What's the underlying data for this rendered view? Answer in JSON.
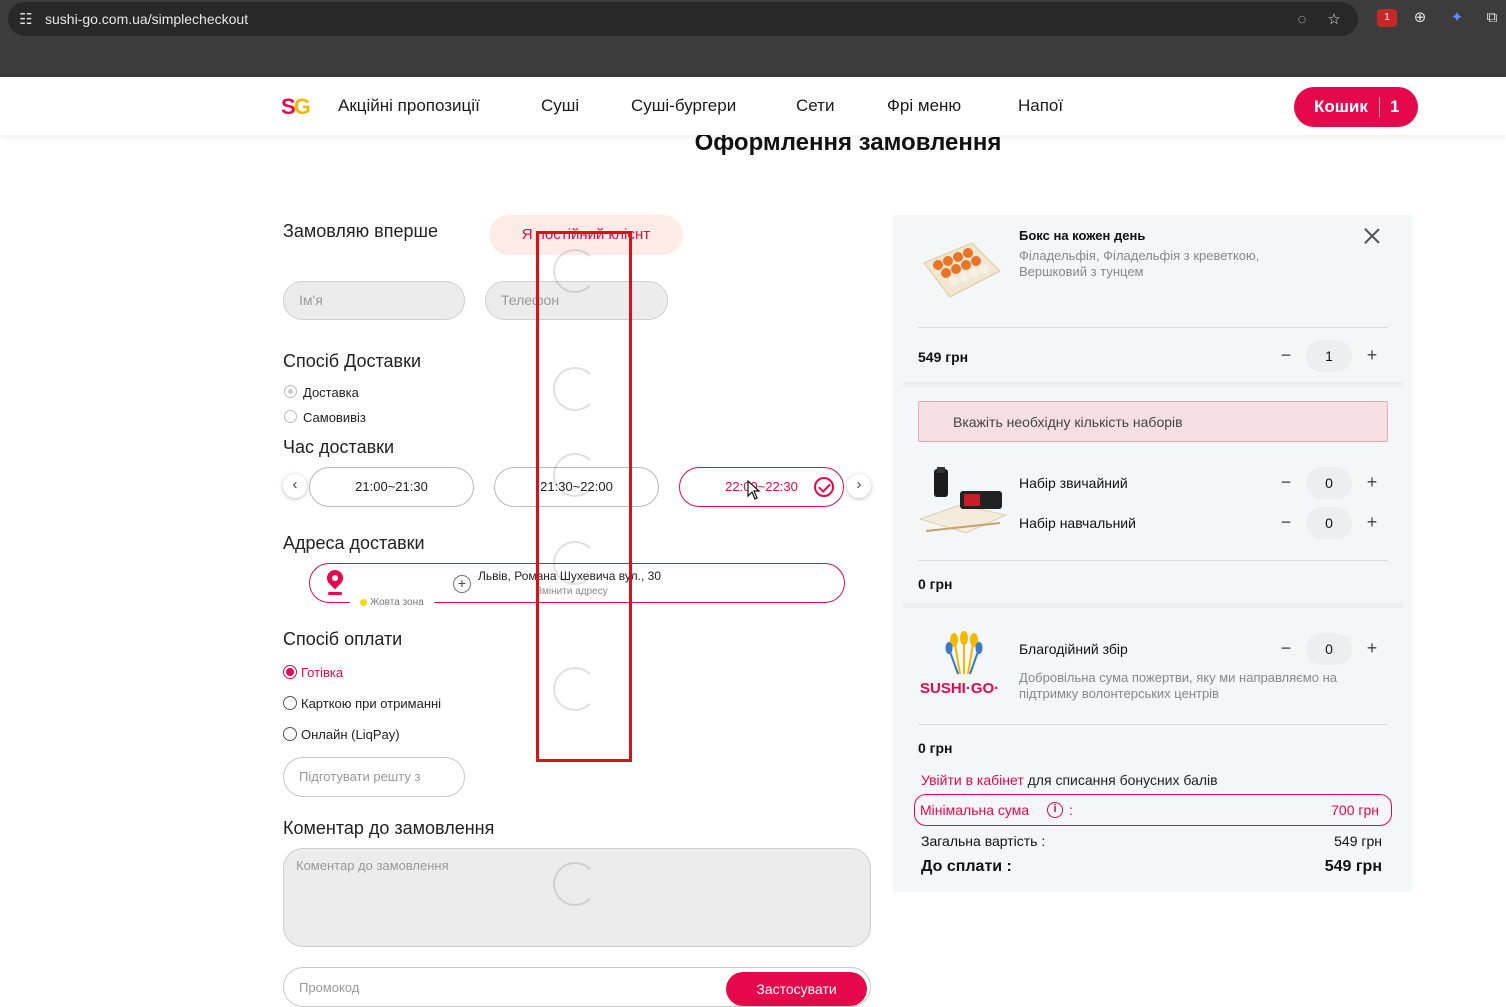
{
  "browser": {
    "url": "sushi-go.com.ua/simplecheckout",
    "extension_badge": "1"
  },
  "header": {
    "logo": {
      "s": "S",
      "g": "G"
    },
    "nav": [
      "Акційні пропозиції",
      "Суші",
      "Суші-бургери",
      "Сети",
      "Фрі меню",
      "Напої"
    ],
    "cart_label": "Кошик",
    "cart_count": "1"
  },
  "page_title": "Оформлення замовлення",
  "customer": {
    "first_time_label": "Замовляю вперше",
    "regular_client_label": "Я постійний клієнт",
    "name_placeholder": "Ім'я",
    "phone_placeholder": "Телефон"
  },
  "delivery": {
    "heading": "Спосіб Доставки",
    "options": [
      {
        "label": "Доставка",
        "selected": true
      },
      {
        "label": "Самовивіз",
        "selected": false
      }
    ]
  },
  "delivery_time": {
    "heading": "Час доставки",
    "slots": [
      {
        "label": "21:00~21:30",
        "active": false
      },
      {
        "label": "21:30~22:00",
        "active": false
      },
      {
        "label": "22:00~22:30",
        "active": true
      }
    ]
  },
  "address": {
    "heading": "Адреса доставки",
    "value": "Львів, Романа Шухевича вул., 30",
    "change_label": "Змінити адресу",
    "zone": "Жовта зона",
    "zone_color": "#f7d31b"
  },
  "payment": {
    "heading": "Спосіб оплати",
    "options": [
      {
        "label": "Готівка",
        "selected": true
      },
      {
        "label": "Карткою при отриманні",
        "selected": false
      },
      {
        "label": "Онлайн (LiqPay)",
        "selected": false
      }
    ],
    "change_placeholder": "Підготувати решту з"
  },
  "comment": {
    "heading": "Коментар до замовлення",
    "placeholder": "Коментар до замовлення"
  },
  "promo": {
    "placeholder": "Промокод",
    "apply_label": "Застосувати"
  },
  "summary": {
    "item": {
      "title": "Бокс на кожен день",
      "description": "Філадельфія, Філадельфія з креветкою, Вершковий з тунцем",
      "price": "549 грн",
      "quantity": "1"
    },
    "sets_warning": "Вкажіть необхідну кількість наборів",
    "sets": [
      {
        "name": "Набір звичайний",
        "quantity": "0"
      },
      {
        "name": "Набір навчальний",
        "quantity": "0"
      }
    ],
    "sets_price": "0 грн",
    "charity": {
      "title": "Благодійний збір",
      "description": "Добровільна сума пожертви, яку ми направляємо на підтримку волонтерських центрів",
      "quantity": "0",
      "price": "0 грн",
      "logo_text": "SUSHI·GO·"
    },
    "login_link": "Увійти в кабінет",
    "login_suffix": " для списання бонусних балів",
    "min_sum_label": "Мінімальна сума",
    "min_sum_colon": ":",
    "min_sum_value": "700 грн",
    "total_label": "Загальна вартість :",
    "total_value": "549 грн",
    "pay_label": "До сплати :",
    "pay_value": "549 грн"
  },
  "colors": {
    "brand": "#e5094c",
    "brand_yellow": "#f3b800",
    "annotation": "#d9111b"
  }
}
